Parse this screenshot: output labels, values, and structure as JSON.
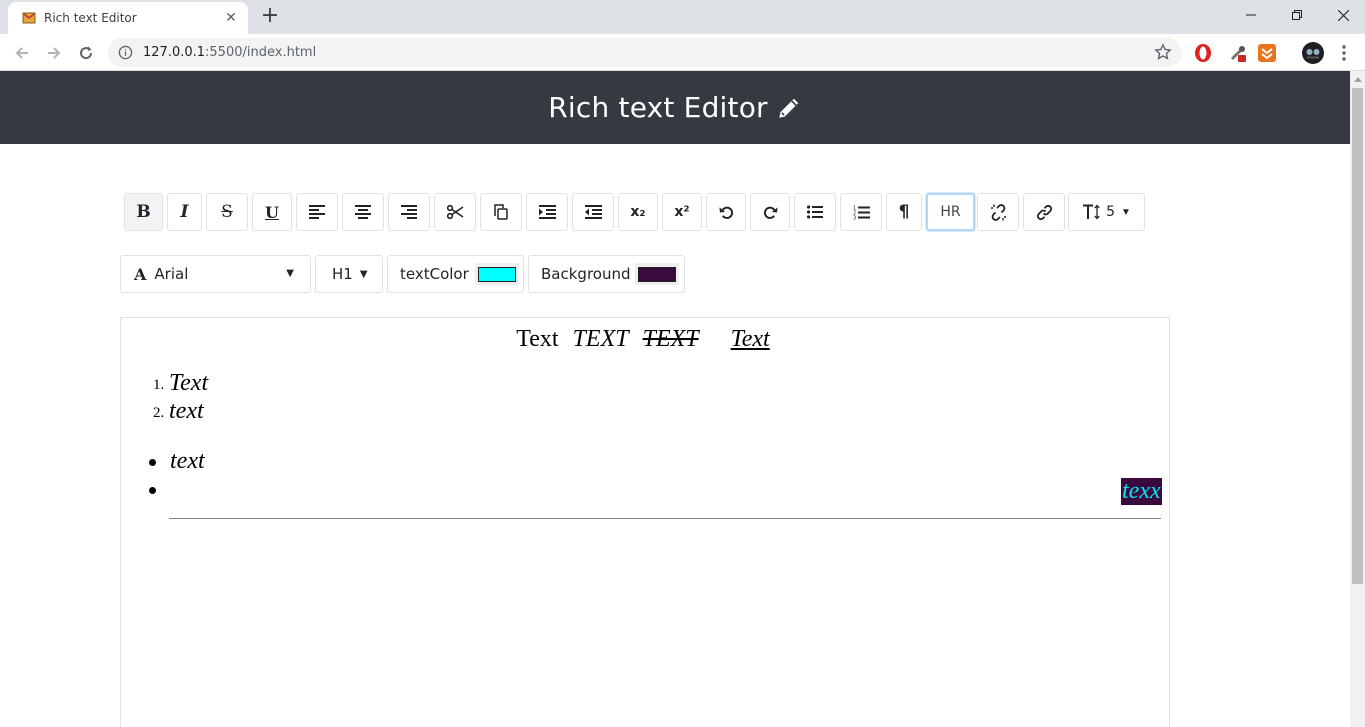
{
  "browser": {
    "tab_title": "Rich text Editor",
    "tab_close": "✕",
    "new_tab": "+",
    "url_host": "127.0.0.1",
    "url_path": ":5500/index.html",
    "win_min": "—",
    "win_max": "❐",
    "win_close": "✕"
  },
  "header": {
    "title": "Rich text Editor",
    "bg_color": "#343a40"
  },
  "toolbar": {
    "buttons": [
      {
        "name": "bold-button",
        "label": "B",
        "icon": "bold"
      },
      {
        "name": "italic-button",
        "label": "I",
        "icon": "italic"
      },
      {
        "name": "strikethrough-button",
        "label": "S",
        "icon": "strikethrough"
      },
      {
        "name": "underline-button",
        "label": "U",
        "icon": "underline"
      },
      {
        "name": "align-left-button",
        "icon": "align-left"
      },
      {
        "name": "align-center-button",
        "icon": "align-center"
      },
      {
        "name": "align-right-button",
        "icon": "align-right"
      },
      {
        "name": "cut-button",
        "icon": "scissors"
      },
      {
        "name": "copy-button",
        "icon": "copy"
      },
      {
        "name": "indent-button",
        "icon": "indent"
      },
      {
        "name": "outdent-button",
        "icon": "outdent"
      },
      {
        "name": "subscript-button",
        "label": "x₂",
        "icon": "subscript"
      },
      {
        "name": "superscript-button",
        "label": "x²",
        "icon": "superscript"
      },
      {
        "name": "undo-button",
        "icon": "undo"
      },
      {
        "name": "redo-button",
        "icon": "redo"
      },
      {
        "name": "bullet-list-button",
        "icon": "list-ul"
      },
      {
        "name": "numbered-list-button",
        "icon": "list-ol"
      },
      {
        "name": "paragraph-button",
        "label": "¶",
        "icon": "paragraph"
      },
      {
        "name": "hr-button",
        "label": "HR"
      },
      {
        "name": "unlink-button",
        "icon": "unlink"
      },
      {
        "name": "link-button",
        "icon": "link"
      },
      {
        "name": "font-size-select",
        "label": "5",
        "icon": "text-height"
      }
    ]
  },
  "format_bar": {
    "font_name": "Arial",
    "heading": "H1",
    "text_color_label": "textColor",
    "text_color": "#00ffff",
    "background_label": "Background",
    "background_color": "#3a0a3f"
  },
  "editor": {
    "line1": [
      "Text",
      "TEXT",
      "TEXT",
      "Text"
    ],
    "ordered_list": [
      {
        "num": "1.",
        "text": "Text"
      },
      {
        "num": "2.",
        "text": "text"
      }
    ],
    "bullet_list": [
      "text",
      ""
    ],
    "highlighted_text": "texx"
  }
}
